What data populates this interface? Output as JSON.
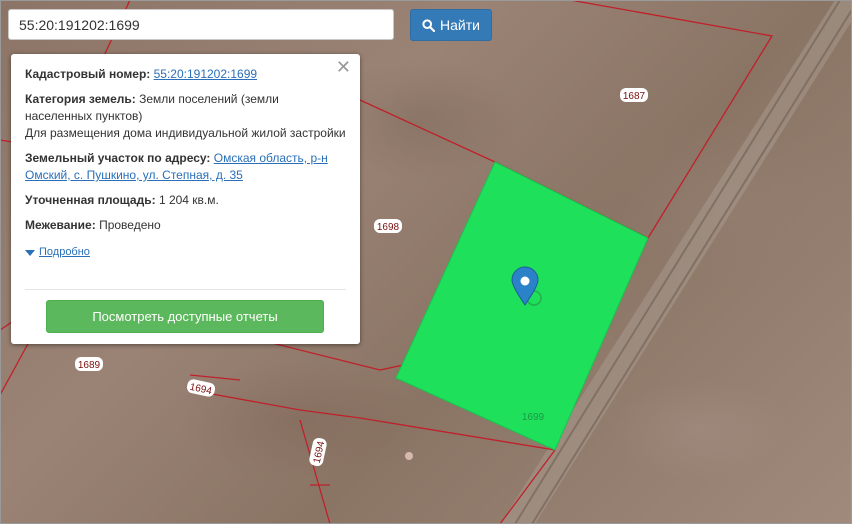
{
  "search": {
    "value": "55:20:191202:1699",
    "button_label": "Найти"
  },
  "popup": {
    "cadastral_label": "Кадастровый номер:",
    "cadastral_value": "55:20:191202:1699",
    "category_label": "Категория земель:",
    "category_value": "Земли поселений (земли населенных пунктов)",
    "usage_value": "Для размещения дома индивидуальной жилой застройки",
    "address_label": "Земельный участок по адресу:",
    "address_value": "Омская область, р-н Омский, с. Пушкино, ул. Степная, д. 35",
    "area_label": "Уточненная площадь:",
    "area_value": "1 204 кв.м.",
    "survey_label": "Межевание:",
    "survey_value": "Проведено",
    "more_label": "Подробно",
    "report_button": "Посмотреть доступные отчеты"
  },
  "map": {
    "parcel_labels": [
      "1687",
      "1698",
      "1689",
      "1694",
      "1694",
      "1699"
    ],
    "selected_parcel_color": "#1ee05a",
    "boundary_color": "#c0202a"
  }
}
